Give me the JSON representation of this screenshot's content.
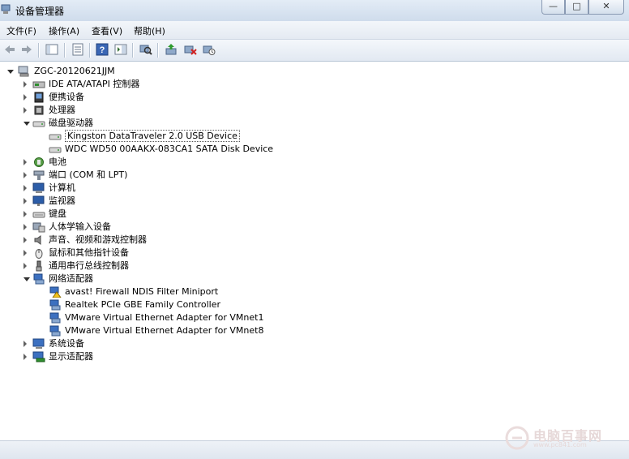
{
  "window": {
    "title": "设备管理器",
    "controls": [
      "minimize",
      "maximize",
      "close"
    ]
  },
  "menu": [
    "文件(F)",
    "操作(A)",
    "查看(V)",
    "帮助(H)"
  ],
  "toolbar_icons": [
    "back-arrow-icon",
    "forward-arrow-icon",
    "show-hide-console-tree-icon",
    "properties-icon",
    "help-icon",
    "action-pane-icon",
    "scan-hardware-icon",
    "update-driver-icon",
    "disable-device-icon",
    "uninstall-device-icon"
  ],
  "tree": {
    "root": "ZGC-20120621JJM",
    "nodes": [
      {
        "label": "IDE ATA/ATAPI 控制器",
        "level": 1,
        "state": "collapsed",
        "icon": "ide-controller-icon"
      },
      {
        "label": "便携设备",
        "level": 1,
        "state": "collapsed",
        "icon": "portable-device-icon"
      },
      {
        "label": "处理器",
        "level": 1,
        "state": "collapsed",
        "icon": "processor-icon"
      },
      {
        "label": "磁盘驱动器",
        "level": 1,
        "state": "expanded",
        "icon": "disk-drive-icon"
      },
      {
        "label": "Kingston DataTraveler 2.0 USB Device",
        "level": 2,
        "state": "leaf",
        "icon": "disk-drive-icon",
        "selected": true
      },
      {
        "label": "WDC WD50 00AAKX-083CA1 SATA Disk Device",
        "level": 2,
        "state": "leaf",
        "icon": "disk-drive-icon"
      },
      {
        "label": "电池",
        "level": 1,
        "state": "collapsed",
        "icon": "battery-icon"
      },
      {
        "label": "端口 (COM 和 LPT)",
        "level": 1,
        "state": "collapsed",
        "icon": "port-icon"
      },
      {
        "label": "计算机",
        "level": 1,
        "state": "collapsed",
        "icon": "computer-icon"
      },
      {
        "label": "监视器",
        "level": 1,
        "state": "collapsed",
        "icon": "monitor-icon"
      },
      {
        "label": "键盘",
        "level": 1,
        "state": "collapsed",
        "icon": "keyboard-icon"
      },
      {
        "label": "人体学输入设备",
        "level": 1,
        "state": "collapsed",
        "icon": "hid-icon"
      },
      {
        "label": "声音、视频和游戏控制器",
        "level": 1,
        "state": "collapsed",
        "icon": "speaker-icon"
      },
      {
        "label": "鼠标和其他指针设备",
        "level": 1,
        "state": "collapsed",
        "icon": "mouse-icon"
      },
      {
        "label": "通用串行总线控制器",
        "level": 1,
        "state": "collapsed",
        "icon": "usb-icon"
      },
      {
        "label": "网络适配器",
        "level": 1,
        "state": "expanded",
        "icon": "network-adapter-icon"
      },
      {
        "label": "avast! Firewall NDIS Filter Miniport",
        "level": 2,
        "state": "leaf",
        "icon": "network-warning-icon"
      },
      {
        "label": "Realtek PCIe GBE Family Controller",
        "level": 2,
        "state": "leaf",
        "icon": "network-adapter-icon"
      },
      {
        "label": "VMware Virtual Ethernet Adapter for VMnet1",
        "level": 2,
        "state": "leaf",
        "icon": "network-adapter-icon"
      },
      {
        "label": "VMware Virtual Ethernet Adapter for VMnet8",
        "level": 2,
        "state": "leaf",
        "icon": "network-adapter-icon"
      },
      {
        "label": "系统设备",
        "level": 1,
        "state": "collapsed",
        "icon": "system-device-icon"
      },
      {
        "label": "显示适配器",
        "level": 1,
        "state": "collapsed",
        "icon": "display-adapter-icon"
      }
    ]
  },
  "watermark": {
    "text": "电脑百事网",
    "sub": "www.pc841.com"
  }
}
